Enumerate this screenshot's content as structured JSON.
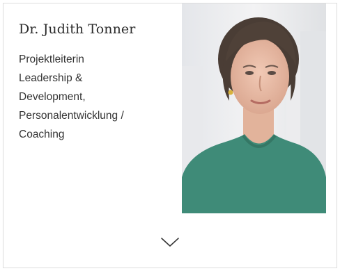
{
  "profile": {
    "name": "Dr. Judith Tonner",
    "role_lines": [
      "Projektleiterin",
      "Leadership &",
      "Development,",
      "Personalentwicklung /",
      "Coaching"
    ],
    "photo_icon": "portrait-photo",
    "expand_icon": "chevron-down-icon"
  },
  "colors": {
    "text": "#333333",
    "border": "#dcdcdc",
    "sweater": "#3f8b78",
    "background": "#ffffff"
  }
}
